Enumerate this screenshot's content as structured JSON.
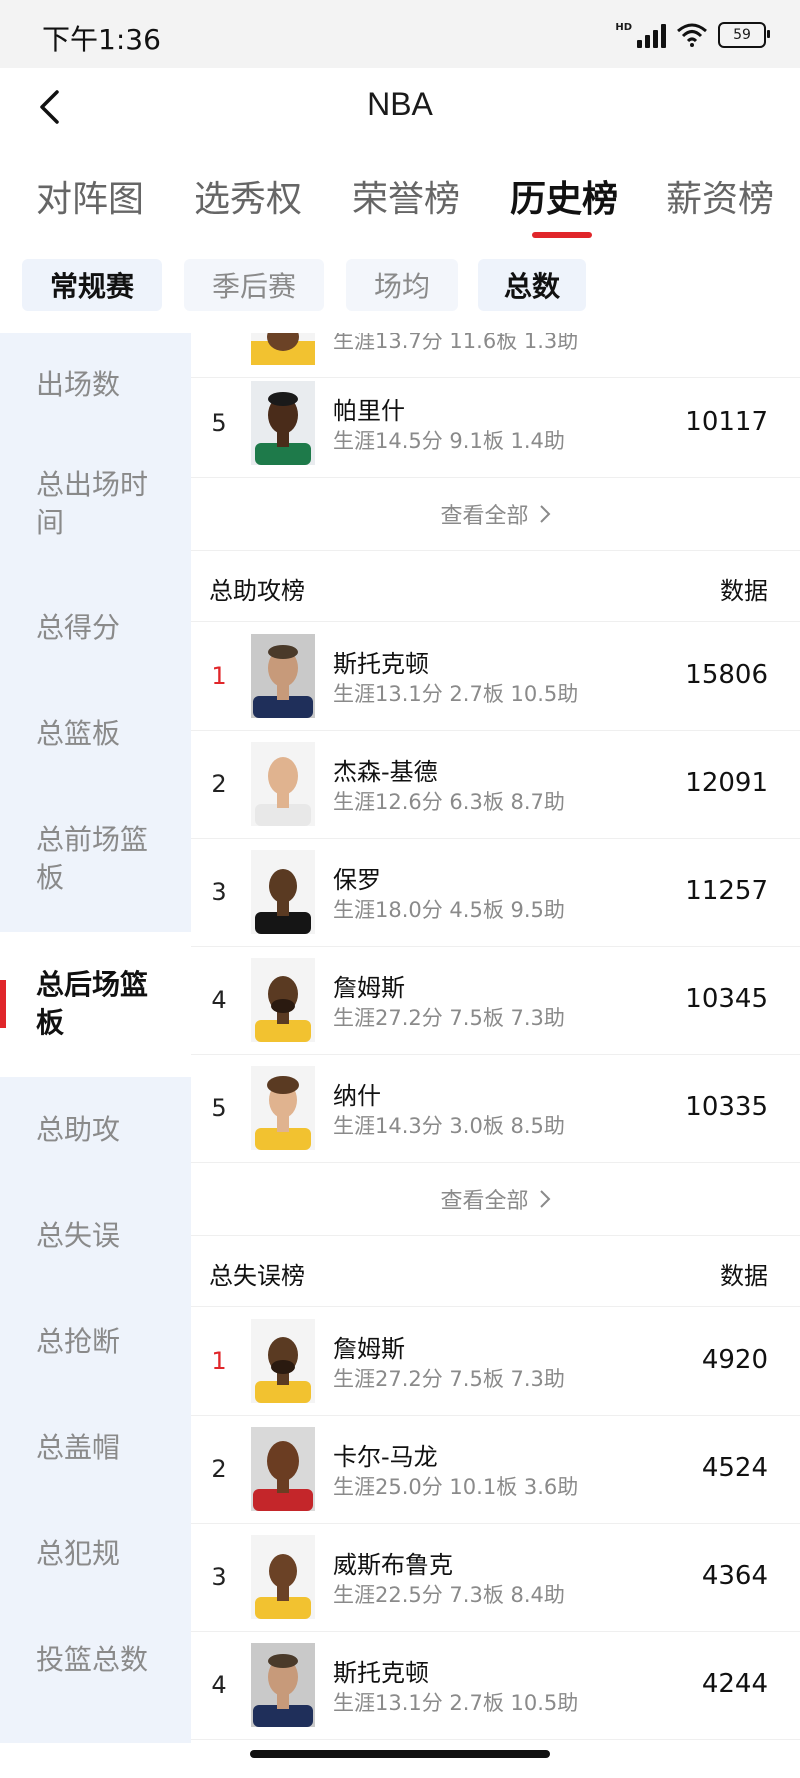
{
  "status_bar": {
    "time": "下午1:36",
    "network": "HD",
    "battery": "59"
  },
  "title": "NBA",
  "main_tabs": [
    "对阵图",
    "选秀权",
    "荣誉榜",
    "历史榜",
    "薪资榜"
  ],
  "active_main_tab": "历史榜",
  "filters": [
    "常规赛",
    "季后赛",
    "场均",
    "总数"
  ],
  "sidebar": {
    "items": [
      "出场数",
      "总出场时间",
      "总得分",
      "总篮板",
      "总前场篮板",
      "总后场篮板",
      "总助攻",
      "总失误",
      "总抢断",
      "总盖帽",
      "总犯规",
      "投篮总数"
    ],
    "active": "总后场篮板"
  },
  "partial_row": {
    "stats": "生涯13.7分 11.6板 1.3助"
  },
  "rebounds_tail": [
    {
      "rank": "5",
      "name": "帕里什",
      "stats": "生涯14.5分 9.1板 1.4助",
      "value": "10117"
    }
  ],
  "see_all_label": "查看全部",
  "column_label": "数据",
  "assists": {
    "title": "总助攻榜",
    "rows": [
      {
        "rank": "1",
        "name": "斯托克顿",
        "stats": "生涯13.1分 2.7板 10.5助",
        "value": "15806"
      },
      {
        "rank": "2",
        "name": "杰森-基德",
        "stats": "生涯12.6分 6.3板 8.7助",
        "value": "12091"
      },
      {
        "rank": "3",
        "name": "保罗",
        "stats": "生涯18.0分 4.5板 9.5助",
        "value": "11257"
      },
      {
        "rank": "4",
        "name": "詹姆斯",
        "stats": "生涯27.2分 7.5板 7.3助",
        "value": "10345"
      },
      {
        "rank": "5",
        "name": "纳什",
        "stats": "生涯14.3分 3.0板 8.5助",
        "value": "10335"
      }
    ]
  },
  "turnovers": {
    "title": "总失误榜",
    "rows": [
      {
        "rank": "1",
        "name": "詹姆斯",
        "stats": "生涯27.2分 7.5板 7.3助",
        "value": "4920"
      },
      {
        "rank": "2",
        "name": "卡尔-马龙",
        "stats": "生涯25.0分 10.1板 3.6助",
        "value": "4524"
      },
      {
        "rank": "3",
        "name": "威斯布鲁克",
        "stats": "生涯22.5分 7.3板 8.4助",
        "value": "4364"
      },
      {
        "rank": "4",
        "name": "斯托克顿",
        "stats": "生涯13.1分 2.7板 10.5助",
        "value": "4244"
      }
    ]
  },
  "colors": {
    "accent": "#e0262a",
    "sidebar_bg": "#eef3fb",
    "muted_text": "#8a8a8a"
  }
}
